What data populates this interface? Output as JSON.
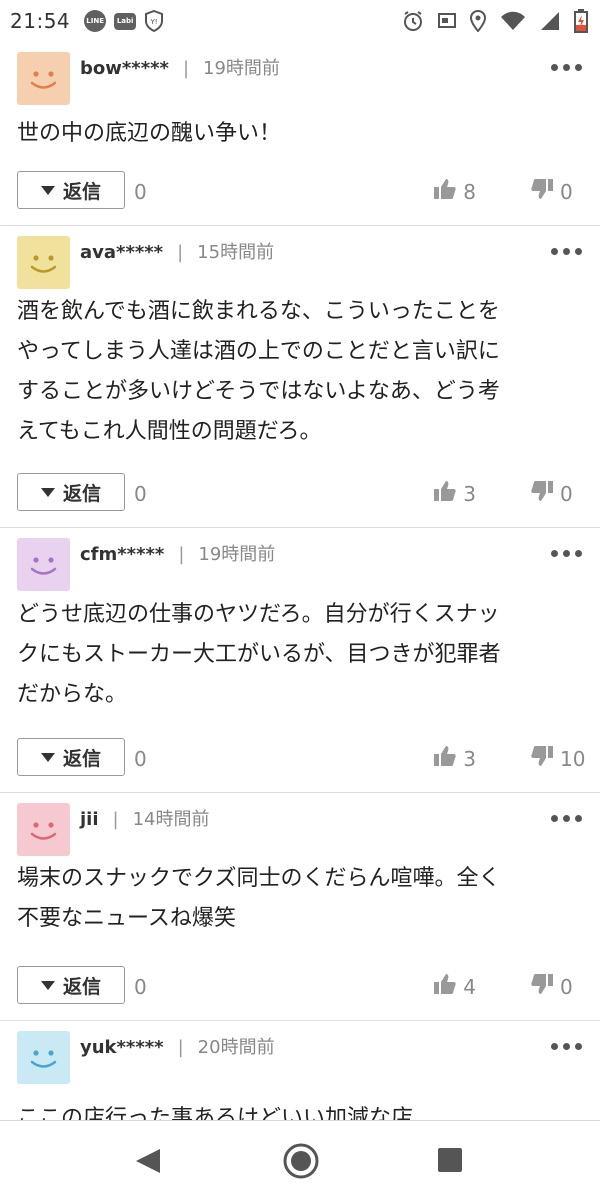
{
  "statusbar": {
    "time": "21:54",
    "app_icons": [
      "LINE",
      "Labi"
    ],
    "icons": [
      "alarm-icon",
      "cast-icon",
      "location-icon",
      "wifi-icon",
      "battery-charging-icon"
    ]
  },
  "colors": {
    "avatar_orange": "#f5cfae",
    "avatar_yellow": "#f0e29c",
    "avatar_purple": "#e9d2f0",
    "avatar_pink": "#f6c8cf",
    "avatar_blue": "#c9e9f5"
  },
  "comments": [
    {
      "user": "bow*****",
      "time": "19時間前",
      "lines": [
        "世の中の底辺の醜い争い！"
      ],
      "reply_label": "返信",
      "reply_count": "0",
      "likes": "8",
      "dislikes": "0"
    },
    {
      "user": "ava*****",
      "time": "15時間前",
      "lines": [
        "酒を飲んでも酒に飲まれるな、こういったことを",
        "やってしまう人達は酒の上でのことだと言い訳に",
        "することが多いけどそうではないよなあ、どう考",
        "えてもこれ人間性の問題だろ。"
      ],
      "reply_label": "返信",
      "reply_count": "0",
      "likes": "3",
      "dislikes": "0"
    },
    {
      "user": "cfm*****",
      "time": "19時間前",
      "lines": [
        "どうせ底辺の仕事のヤツだろ。自分が行くスナッ",
        "クにもストーカー大工がいるが、目つきが犯罪者",
        "だからな。"
      ],
      "reply_label": "返信",
      "reply_count": "0",
      "likes": "3",
      "dislikes": "10"
    },
    {
      "user": "jii",
      "time": "14時間前",
      "lines": [
        "場末のスナックでクズ同士のくだらん喧嘩。全く",
        "不要なニュースね爆笑"
      ],
      "reply_label": "返信",
      "reply_count": "0",
      "likes": "4",
      "dislikes": "0"
    },
    {
      "user": "yuk*****",
      "time": "20時間前",
      "lines": [
        "ここの店行った事あるけどいい加減な店"
      ]
    }
  ]
}
